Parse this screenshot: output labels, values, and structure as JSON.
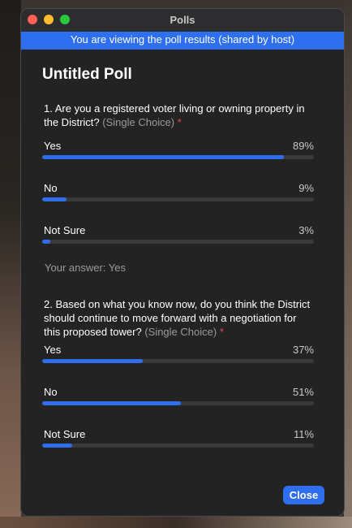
{
  "window": {
    "title": "Polls"
  },
  "banner": {
    "text": "You are viewing the poll results (shared by host)"
  },
  "poll": {
    "title": "Untitled Poll",
    "questions": [
      {
        "text": "1. Are you a registered voter living or owning property in the District?",
        "type": "(Single Choice)",
        "required_mark": "*",
        "options": [
          {
            "label": "Yes",
            "percent": "89%",
            "value": 89
          },
          {
            "label": "No",
            "percent": "9%",
            "value": 9
          },
          {
            "label": "Not Sure",
            "percent": "3%",
            "value": 3
          }
        ],
        "your_answer": "Your answer: Yes"
      },
      {
        "text": "2. Based on what you know now, do you think the District should continue to move forward with a negotiation for this proposed tower?",
        "type": "(Single Choice)",
        "required_mark": "*",
        "options": [
          {
            "label": "Yes",
            "percent": "37%",
            "value": 37
          },
          {
            "label": "No",
            "percent": "51%",
            "value": 51
          },
          {
            "label": "Not Sure",
            "percent": "11%",
            "value": 11
          }
        ]
      }
    ]
  },
  "footer": {
    "close_label": "Close"
  },
  "colors": {
    "accent": "#2e6ff0",
    "required": "#e24a4a",
    "background": "#232324"
  }
}
